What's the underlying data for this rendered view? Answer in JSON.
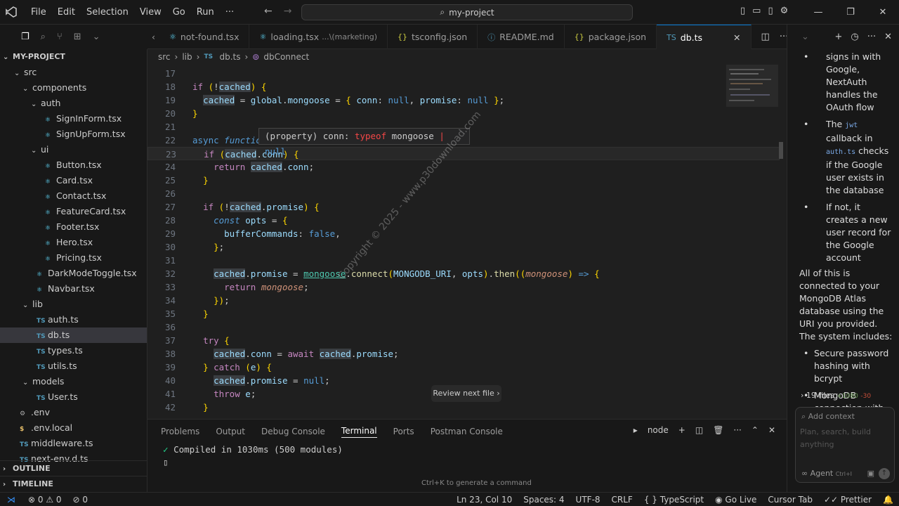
{
  "titlebar": {
    "menus": [
      "File",
      "Edit",
      "Selection",
      "View",
      "Go",
      "Run",
      "···"
    ],
    "search_text": "my-project"
  },
  "tabs": [
    {
      "name": "not-found.tsx",
      "icon": "react-icon",
      "active": false
    },
    {
      "name": "loading.tsx",
      "detail": "...\\(marketing)",
      "icon": "react-icon",
      "active": false
    },
    {
      "name": "tsconfig.json",
      "icon": "json-icon",
      "active": false
    },
    {
      "name": "README.md",
      "icon": "info-icon",
      "active": false
    },
    {
      "name": "package.json",
      "icon": "braces-icon",
      "active": false
    },
    {
      "name": "db.ts",
      "icon": "ts-icon",
      "active": true
    }
  ],
  "breadcrumb": [
    "src",
    "lib",
    "db.ts",
    "dbConnect"
  ],
  "explorer": {
    "title": "MY-PROJECT",
    "items": [
      {
        "label": "src",
        "type": "folder",
        "depth": 1,
        "open": true
      },
      {
        "label": "components",
        "type": "folder",
        "depth": 2,
        "open": true
      },
      {
        "label": "auth",
        "type": "folder",
        "depth": 3,
        "open": true
      },
      {
        "label": "SignInForm.tsx",
        "type": "react",
        "depth": 4
      },
      {
        "label": "SignUpForm.tsx",
        "type": "react",
        "depth": 4
      },
      {
        "label": "ui",
        "type": "folder",
        "depth": 3,
        "open": true
      },
      {
        "label": "Button.tsx",
        "type": "react",
        "depth": 4
      },
      {
        "label": "Card.tsx",
        "type": "react",
        "depth": 4
      },
      {
        "label": "Contact.tsx",
        "type": "react",
        "depth": 4
      },
      {
        "label": "FeatureCard.tsx",
        "type": "react",
        "depth": 4
      },
      {
        "label": "Footer.tsx",
        "type": "react",
        "depth": 4
      },
      {
        "label": "Hero.tsx",
        "type": "react",
        "depth": 4
      },
      {
        "label": "Pricing.tsx",
        "type": "react",
        "depth": 4
      },
      {
        "label": "DarkModeToggle.tsx",
        "type": "react",
        "depth": 3
      },
      {
        "label": "Navbar.tsx",
        "type": "react",
        "depth": 3
      },
      {
        "label": "lib",
        "type": "folder",
        "depth": 2,
        "open": true
      },
      {
        "label": "auth.ts",
        "type": "ts",
        "depth": 3
      },
      {
        "label": "db.ts",
        "type": "ts",
        "depth": 3,
        "selected": true
      },
      {
        "label": "types.ts",
        "type": "ts",
        "depth": 3
      },
      {
        "label": "utils.ts",
        "type": "ts",
        "depth": 3
      },
      {
        "label": "models",
        "type": "folder",
        "depth": 2,
        "open": true
      },
      {
        "label": "User.ts",
        "type": "ts",
        "depth": 3
      },
      {
        "label": ".env",
        "type": "gear",
        "depth": 1
      },
      {
        "label": ".env.local",
        "type": "dollar",
        "depth": 1
      },
      {
        "label": "middleware.ts",
        "type": "ts",
        "depth": 1
      },
      {
        "label": "next-env.d.ts",
        "type": "ts",
        "depth": 1
      }
    ],
    "outline": "OUTLINE",
    "timeline": "TIMELINE"
  },
  "editor": {
    "lines": [
      {
        "n": "17",
        "html": ""
      },
      {
        "n": "18",
        "html": "<span class='kw'>if</span> <span class='yl'>(</span>!<span class='vr hl'>cached</span><span class='yl'>)</span> <span class='yl'>{</span>"
      },
      {
        "n": "19",
        "html": "  <span class='vr hl'>cached</span> = <span class='vr'>global</span>.<span class='vr'>mongoose</span> = <span class='yl'>{</span> <span class='vr'>conn</span>: <span class='bl'>null</span>, <span class='vr'>promise</span>: <span class='bl'>null</span> <span class='yl'>}</span>;"
      },
      {
        "n": "20",
        "html": "<span class='yl'>}</span>"
      },
      {
        "n": "21",
        "html": ""
      },
      {
        "n": "22",
        "html": "<span class='bl'>async</span> <span class='bl ital'>functio</span>"
      },
      {
        "n": "23",
        "html": "  <span class='kw'>if</span> <span class='yl'>(</span><span class='vr hl'>cached</span>.<span class='vr'>conn</span><span class='yl'>)</span> <span class='yl'>{</span>",
        "current": true
      },
      {
        "n": "24",
        "html": "    <span class='kw'>return</span> <span class='vr hl'>cached</span>.<span class='vr'>conn</span>;"
      },
      {
        "n": "25",
        "html": "  <span class='yl'>}</span>"
      },
      {
        "n": "26",
        "html": ""
      },
      {
        "n": "27",
        "html": "  <span class='kw'>if</span> <span class='yl'>(</span>!<span class='vr hl'>cached</span>.<span class='vr'>promise</span><span class='yl'>)</span> <span class='yl'>{</span>"
      },
      {
        "n": "28",
        "html": "    <span class='bl ital'>const</span> <span class='vr'>opts</span> = <span class='yl'>{</span>"
      },
      {
        "n": "29",
        "html": "      <span class='vr'>bufferCommands</span>: <span class='bl'>false</span>,"
      },
      {
        "n": "30",
        "html": "    <span class='yl'>}</span>;"
      },
      {
        "n": "31",
        "html": ""
      },
      {
        "n": "32",
        "html": "    <span class='vr hl'>cached</span>.<span class='vr'>promise</span> = <span class='vr' style='text-decoration:underline;color:#4ec9b0'>mongoose</span>.<span class='fn'>connect</span><span class='yl'>(</span><span class='vr'>MONGODB_URI</span>, <span class='vr'>opts</span><span class='yl'>)</span>.<span class='fn'>then</span><span class='yl'>((</span><span class='vr ital' style='color:#ce9178'>mongoose</span><span class='yl'>)</span> <span class='bl'>=&gt;</span> <span class='yl'>{</span>"
      },
      {
        "n": "33",
        "html": "      <span class='kw'>return</span> <span class='vr ital' style='color:#ce9178'>mongoose</span>;"
      },
      {
        "n": "34",
        "html": "    <span class='yl'>})</span>;"
      },
      {
        "n": "35",
        "html": "  <span class='yl'>}</span>"
      },
      {
        "n": "36",
        "html": ""
      },
      {
        "n": "37",
        "html": "  <span class='kw'>try</span> <span class='yl'>{</span>"
      },
      {
        "n": "38",
        "html": "    <span class='vr hl'>cached</span>.<span class='vr'>conn</span> = <span class='kw'>await</span> <span class='vr hl'>cached</span>.<span class='vr'>promise</span>;"
      },
      {
        "n": "39",
        "html": "  <span class='yl'>}</span> <span class='kw'>catch</span> <span class='yl'>(</span><span class='vr'>e</span><span class='yl'>)</span> <span class='yl'>{</span>"
      },
      {
        "n": "40",
        "html": "    <span class='vr hl'>cached</span>.<span class='vr'>promise</span> = <span class='bl'>null</span>;"
      },
      {
        "n": "41",
        "html": "    <span class='kw'>throw</span> <span class='vr'>e</span>;"
      },
      {
        "n": "42",
        "html": "  <span class='yl'>}</span>"
      }
    ],
    "hover_property": "(property) conn: ",
    "hover_typeof": "typeof",
    "hover_type": " mongoose ",
    "hover_sep": "|",
    "hover_null": " null",
    "watermark": "Copyright © 2025 - www.p30download.com",
    "review_next": "Review next file"
  },
  "panel": {
    "tabs": [
      "Problems",
      "Output",
      "Debug Console",
      "Terminal",
      "Ports",
      "Postman Console"
    ],
    "active_tab": "Terminal",
    "shell": "node",
    "terminal_line": "Compiled in 1030ms (500 modules)",
    "hint": "Ctrl+K to generate a command"
  },
  "chat": {
    "para1": "signs in with Google, NextAuth handles the OAuth flow",
    "bullet2_a": "The ",
    "bullet2_code1": "jwt",
    "bullet2_b": " callback in ",
    "bullet2_code2": "auth.ts",
    "bullet2_c": " checks if the Google user exists in the database",
    "bullet3": "If not, it creates a new user record for the Google account",
    "para2": "All of this is connected to your MongoDB Atlas database using the URI you provided. The system includes:",
    "bullet4": "Secure password hashing with bcrypt",
    "bullet5": "MongoDB connection with connection pooling",
    "files_summary": "19 files",
    "files_added": "+1080",
    "files_removed": "-30",
    "add_context": "Add context",
    "input_placeholder": "Plan, search, build anything",
    "agent_label": "Agent",
    "agent_shortcut": "Ctrl+I"
  },
  "statusbar": {
    "errors": "0",
    "warnings": "0",
    "ports": "0",
    "position": "Ln 23, Col 10",
    "spaces": "Spaces: 4",
    "encoding": "UTF-8",
    "eol": "CRLF",
    "language": "TypeScript",
    "golive": "Go Live",
    "cursortab": "Cursor Tab",
    "prettier": "Prettier"
  },
  "colors": {
    "accent": "#0078d4",
    "ts": "#519aba"
  }
}
